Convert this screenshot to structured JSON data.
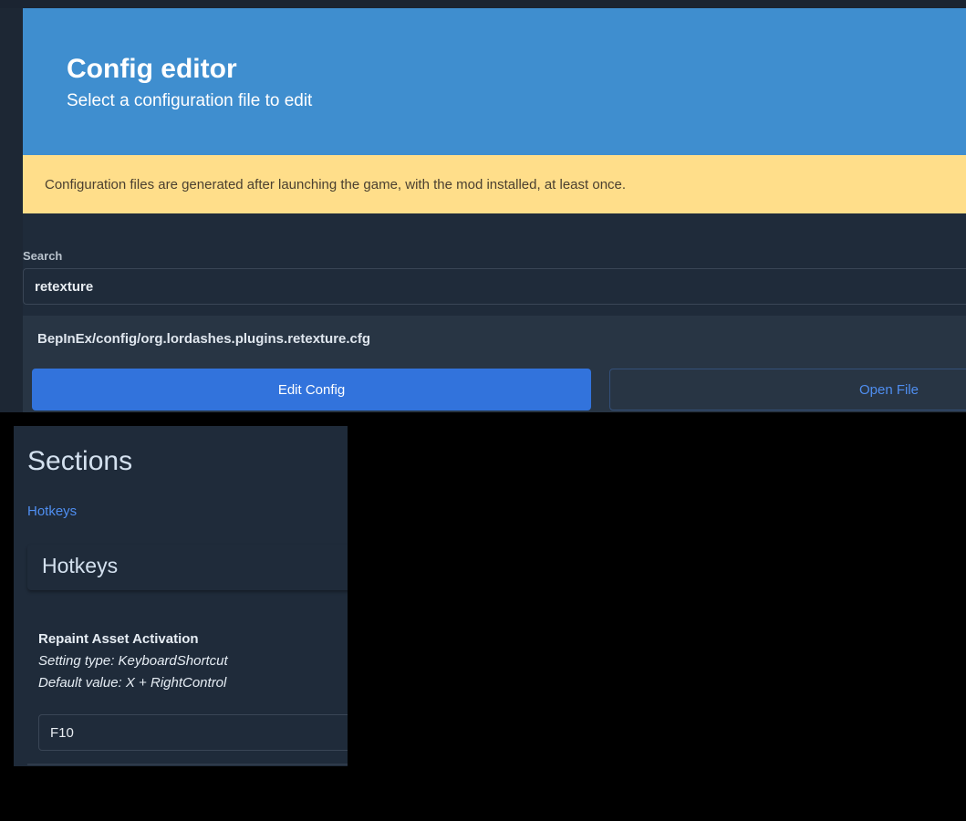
{
  "header": {
    "title": "Config editor",
    "subtitle": "Select a configuration file to edit"
  },
  "notice": "Configuration files are generated after launching the game, with the mod installed, at least once.",
  "search": {
    "label": "Search",
    "value": "retexture"
  },
  "result": {
    "path": "BepInEx/config/org.lordashes.plugins.retexture.cfg",
    "edit_label": "Edit Config",
    "open_label": "Open File"
  },
  "sections": {
    "title": "Sections",
    "links": [
      "Hotkeys"
    ],
    "section_title": "Hotkeys",
    "setting": {
      "name": "Repaint Asset Activation",
      "type": "Setting type: KeyboardShortcut",
      "default": "Default value: X + RightControl",
      "value": "F10"
    }
  },
  "colors": {
    "header": "#3f8ecf",
    "notice": "#ffde8a",
    "primary": "#3273dc",
    "link": "#4f8ef0",
    "background": "#1f2b3a"
  }
}
